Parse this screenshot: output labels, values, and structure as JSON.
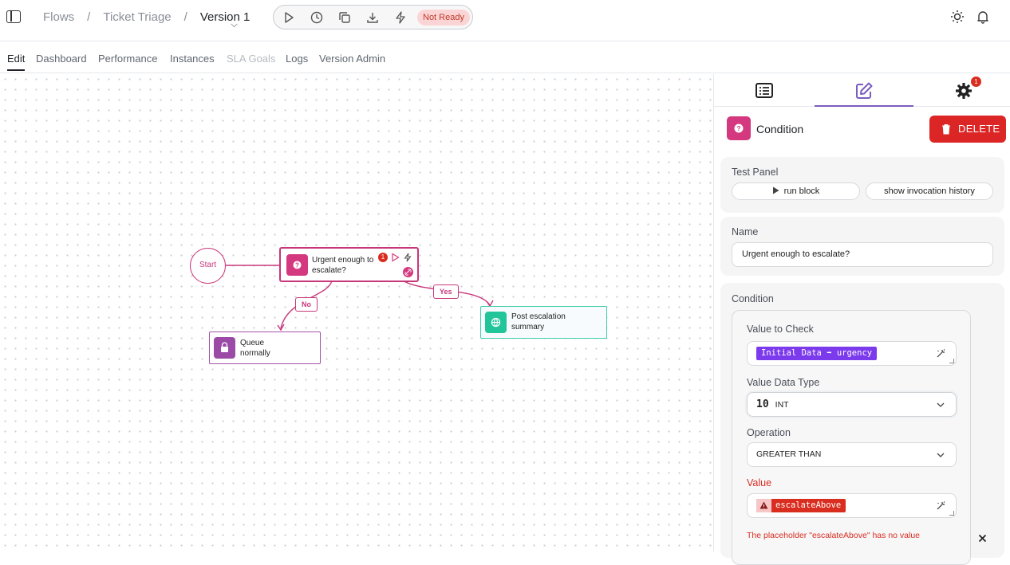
{
  "header": {
    "breadcrumbs": [
      "Flows",
      "Ticket Triage",
      "Version 1"
    ],
    "status_badge": "Not Ready"
  },
  "tabs": {
    "edit": "Edit",
    "dashboard": "Dashboard",
    "performance": "Performance",
    "instances": "Instances",
    "sla_goals": "SLA Goals",
    "logs": "Logs",
    "version_admin": "Version Admin"
  },
  "canvas": {
    "start_label": "Start",
    "condition_node": {
      "line1": "Urgent enough to",
      "line2": "escalate?",
      "error_count": "1"
    },
    "queue_node": {
      "line1": "Queue",
      "line2": "normally"
    },
    "post_node": {
      "line1": "Post escalation",
      "line2": "summary"
    },
    "edge_no": "No",
    "edge_yes": "Yes"
  },
  "panel": {
    "settings_badge": "1",
    "title": "Condition",
    "delete_label": "DELETE",
    "test_panel": {
      "label": "Test Panel",
      "run_block": "run block",
      "show_history": "show invocation history"
    },
    "name": {
      "label": "Name",
      "value": "Urgent enough to escalate?"
    },
    "condition": {
      "label": "Condition",
      "value_to_check_label": "Value to Check",
      "value_to_check_chip_source": "Initial Data",
      "value_to_check_chip_field": "urgency",
      "data_type_label": "Value Data Type",
      "data_type_prefix": "10",
      "data_type_value": "INT",
      "operation_label": "Operation",
      "operation_value": "GREATER THAN",
      "value_label": "Value",
      "value_chip": "escalateAbove",
      "error_message": "The placeholder \"escalateAbove\" has no value"
    }
  },
  "colors": {
    "brand_pink": "#d4387e",
    "accent_purple": "#7c3aed",
    "danger": "#dc2626",
    "teal": "#22c59a"
  }
}
